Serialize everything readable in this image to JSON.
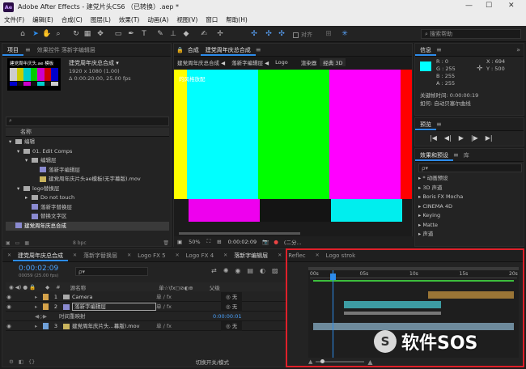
{
  "app": {
    "icon_text": "Ae",
    "window_title": "Adobe After Effects - 建党片头CS6 （已转换）.aep *",
    "minimize": "—",
    "maximize": "☐",
    "close": "✕"
  },
  "menu": [
    "文件(F)",
    "编辑(E)",
    "合成(C)",
    "图层(L)",
    "效果(T)",
    "动画(A)",
    "视图(V)",
    "窗口",
    "帮助(H)"
  ],
  "toolbar": {
    "snap_label": "对齐",
    "search_placeholder": "搜索帮助"
  },
  "project": {
    "tabs": [
      "项目",
      "效果控件 落新字编辑层"
    ],
    "comp_name": "建党周年庆总合成 ▾",
    "thumb_title": "建党周年庆头.ae 模板",
    "resolution": "1920 x 1080 (1.00)",
    "duration": "Δ 0:00:20:00, 25.00 fps",
    "search_icon": "⌕",
    "col_name": "名称",
    "items": [
      {
        "indent": 0,
        "type": "folder",
        "label": "编辑",
        "tw": "▾"
      },
      {
        "indent": 1,
        "type": "folder",
        "label": "01. Edit Comps",
        "tw": "▾"
      },
      {
        "indent": 2,
        "type": "folder",
        "label": "编辑层",
        "tw": "▾"
      },
      {
        "indent": 3,
        "type": "comp",
        "label": "落新字编辑层",
        "tw": ""
      },
      {
        "indent": 3,
        "type": "video",
        "label": "建党周年庆片头ae模板(无字幕版).mov",
        "tw": ""
      },
      {
        "indent": 1,
        "type": "folder",
        "label": "logo替换层",
        "tw": "▾"
      },
      {
        "indent": 2,
        "type": "folder",
        "label": "Do not touch",
        "tw": "▸"
      },
      {
        "indent": 2,
        "type": "comp",
        "label": "落新字替换层",
        "tw": ""
      },
      {
        "indent": 2,
        "type": "comp",
        "label": "替换文字区",
        "tw": ""
      },
      {
        "indent": 0,
        "type": "comp",
        "label": "建党周年庆总合成",
        "tw": "",
        "selected": true
      }
    ],
    "bpc": "8 bpc"
  },
  "viewer": {
    "tabs": [
      "建党周年庆总合成",
      "落新字编辑层",
      "Logo",
      "渲染器",
      "经典 3D"
    ],
    "comp_tab_prefix": "合成",
    "overlay_text": "的风格放配",
    "zoom": "50%",
    "timecode": "0:00:02:09",
    "quality": "(二分..."
  },
  "info": {
    "tab": "信息",
    "r": "R : 0",
    "g": "G : 255",
    "b": "B : 255",
    "a": "A : 255",
    "x": "X : 694",
    "y": "Y : 500",
    "keyframe_time": "关键帧时间: 0:00:00:19",
    "keyframe_type": "如何: 自动贝塞尔曲线",
    "swatch_color": "#00ffff"
  },
  "preview": {
    "tab": "预览",
    "controls": [
      "|◀",
      "◀|",
      "▶",
      "|▶",
      "▶|"
    ]
  },
  "effects": {
    "tabs": [
      "效果和预设",
      "库"
    ],
    "search_placeholder": "ρ▾",
    "items": [
      "▸ * 动画预设",
      "▸ 3D 声道",
      "▸ Boris FX Mocha",
      "▸ CINEMA 4D",
      "▸ Keying",
      "▸ Matte",
      "▸ 声道"
    ]
  },
  "timeline": {
    "tabs": [
      "建党周年庆总合成",
      "落新字替换层",
      "Logo FX 5",
      "Logo FX 4",
      "落新字编辑层",
      "Reflec",
      "Logo strok"
    ],
    "timecode": "0:00:02:09",
    "fps_info": "00059 (25.00 fps)",
    "search_placeholder": "ρ▾",
    "col_num": "#",
    "col_source": "源名称",
    "col_parent": "父级",
    "layers": [
      {
        "num": "1",
        "name": "Camera",
        "color": "#d4a24a",
        "parent": "◎ 无"
      },
      {
        "num": "2",
        "name": "落新字编辑层",
        "color": "#d4a24a",
        "parent": "◎ 无",
        "boxed": true
      },
      {
        "num": "",
        "name": "时间重映射",
        "color": "",
        "parent": "",
        "sub": true,
        "value": "0:00:00:01"
      },
      {
        "num": "3",
        "name": "建党周年庆片头...幕版).mov",
        "color": "#6fa0d8",
        "parent": "◎ 无"
      }
    ],
    "ruler": [
      "00s",
      "05s",
      "10s",
      "15s",
      "20s"
    ],
    "switch_mode": "切换开关/模式"
  },
  "watermark": {
    "text": "软件SOS",
    "mark": "S"
  },
  "bars": [
    "#ffff00",
    "#00ffff",
    "#00ff00",
    "#ff00ff",
    "#ff0000"
  ]
}
